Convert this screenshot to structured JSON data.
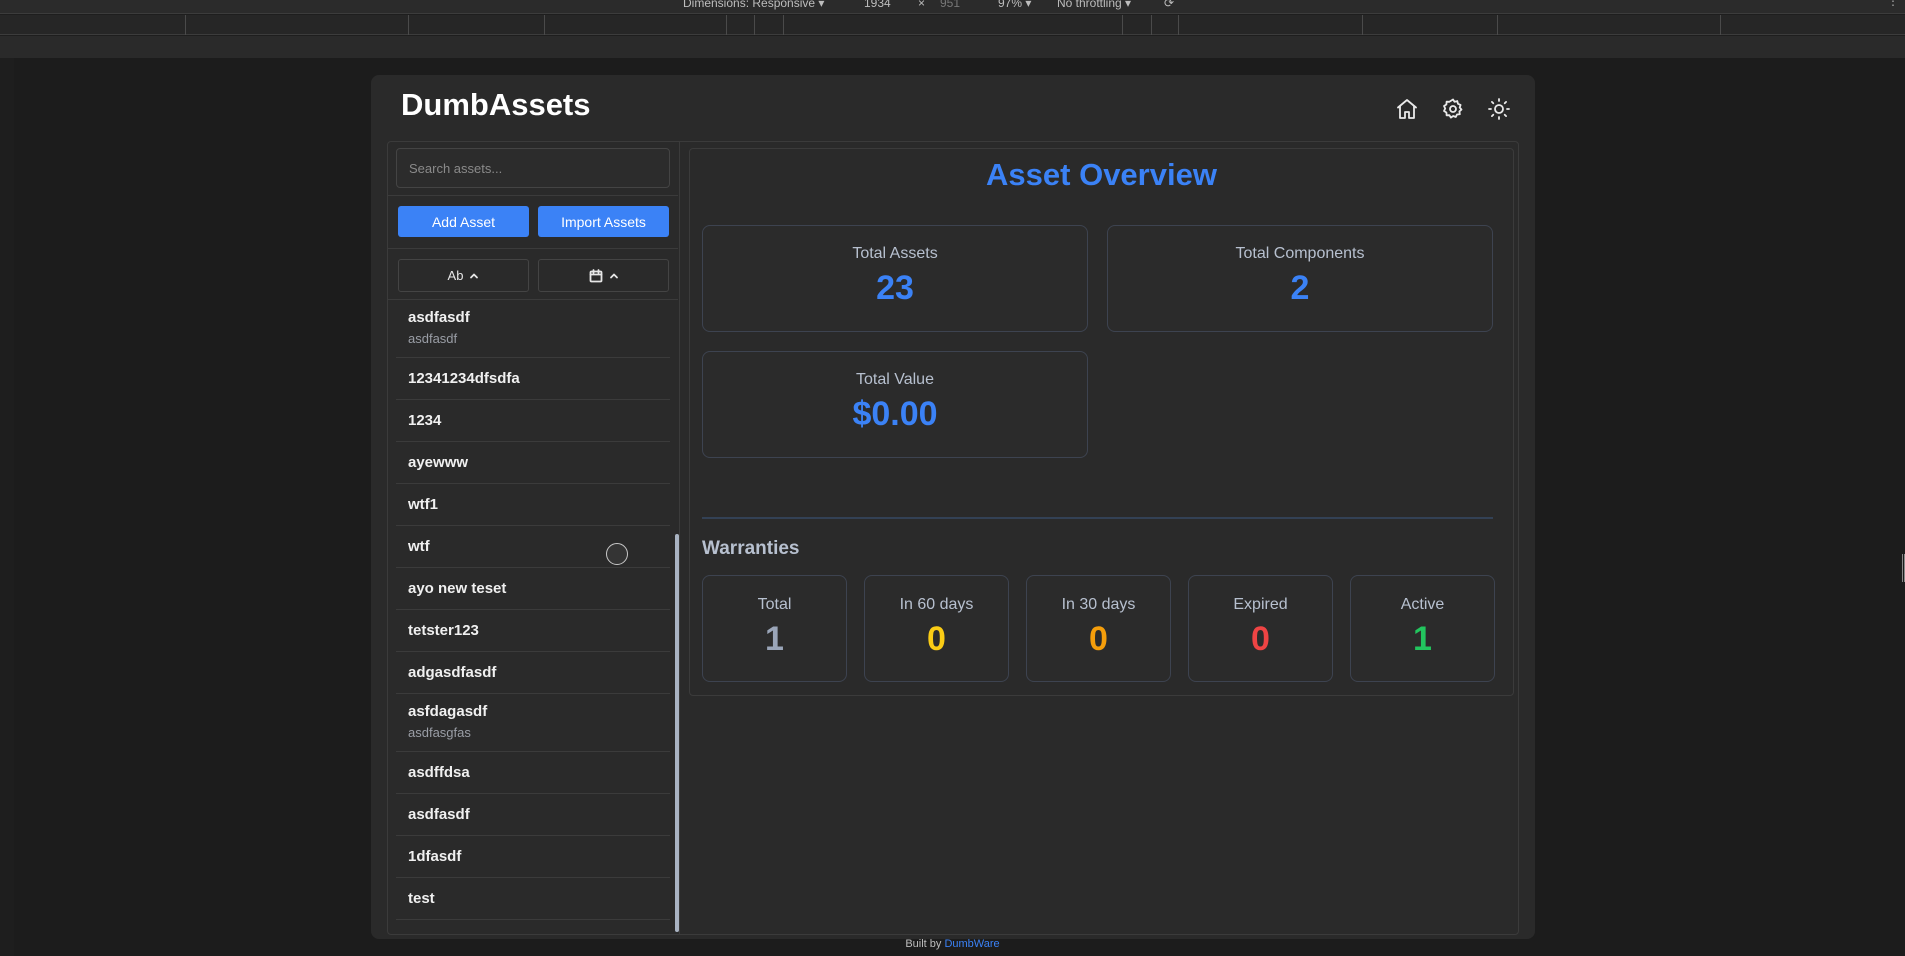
{
  "devtools": {
    "dimensions_label": "Dimensions: Responsive ▾",
    "width": "1934",
    "times": "×",
    "height": "951",
    "zoom": "97% ▾",
    "throttle": "No throttling ▾"
  },
  "app": {
    "title": "DumbAssets"
  },
  "header_icons": [
    "home-icon",
    "gear-icon",
    "sun-icon"
  ],
  "sidebar": {
    "search_placeholder": "Search assets...",
    "add_label": "Add Asset",
    "import_label": "Import Assets",
    "sort_name_label": "Ab",
    "assets": [
      {
        "name": "asdfasdf",
        "sub": "asdfasdf"
      },
      {
        "name": "12341234dfsdfa",
        "sub": ""
      },
      {
        "name": "1234",
        "sub": ""
      },
      {
        "name": "ayewww",
        "sub": ""
      },
      {
        "name": "wtf1",
        "sub": ""
      },
      {
        "name": "wtf",
        "sub": ""
      },
      {
        "name": "ayo new teset",
        "sub": ""
      },
      {
        "name": "tetster123",
        "sub": ""
      },
      {
        "name": "adgasdfasdf",
        "sub": ""
      },
      {
        "name": "asfdagasdf",
        "sub": "asdfasgfas"
      },
      {
        "name": "asdffdsa",
        "sub": ""
      },
      {
        "name": "asdfasdf",
        "sub": ""
      },
      {
        "name": "1dfasdf",
        "sub": ""
      },
      {
        "name": "test",
        "sub": ""
      }
    ]
  },
  "overview": {
    "title": "Asset Overview",
    "total_assets_label": "Total Assets",
    "total_assets": "23",
    "total_components_label": "Total Components",
    "total_components": "2",
    "total_value_label": "Total Value",
    "total_value": "$0.00"
  },
  "warranties": {
    "title": "Warranties",
    "cards": [
      {
        "label": "Total",
        "value": "1",
        "color": "#9aa5b8"
      },
      {
        "label": "In 60 days",
        "value": "0",
        "color": "#facc15"
      },
      {
        "label": "In 30 days",
        "value": "0",
        "color": "#f59e0b"
      },
      {
        "label": "Expired",
        "value": "0",
        "color": "#ef4444"
      },
      {
        "label": "Active",
        "value": "1",
        "color": "#22c55e"
      }
    ]
  },
  "footer": {
    "prefix": "Built by",
    "link": "DumbWare"
  }
}
